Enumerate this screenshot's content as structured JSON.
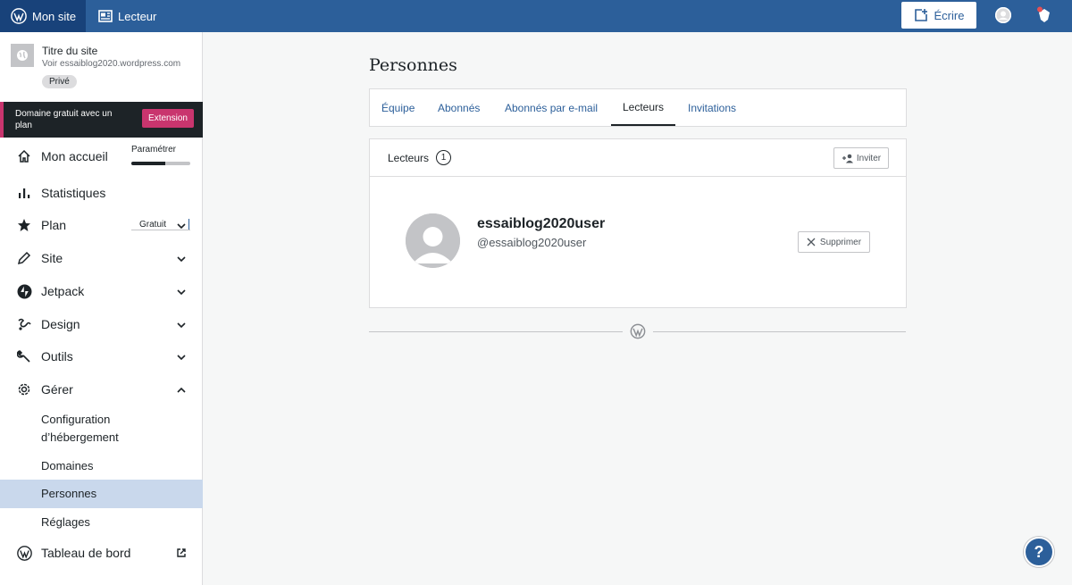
{
  "topbar": {
    "my_site": "Mon site",
    "reader": "Lecteur",
    "write": "Écrire"
  },
  "site": {
    "title": "Titre du site",
    "url": "Voir essaiblog2020.wordpress.com",
    "badge": "Privé"
  },
  "upsell": {
    "text": "Domaine gratuit avec un plan",
    "button": "Extension"
  },
  "nav": {
    "home": {
      "label": "Mon accueil",
      "extra": "Paramétrer",
      "progress_fraction": 0.58
    },
    "stats": {
      "label": "Statistiques"
    },
    "plan": {
      "label": "Plan",
      "extra": "Gratuit"
    },
    "site": {
      "label": "Site"
    },
    "jetpack": {
      "label": "Jetpack"
    },
    "design": {
      "label": "Design"
    },
    "tools": {
      "label": "Outils"
    },
    "manage": {
      "label": "Gérer",
      "sub": [
        "Configuration d’hébergement",
        "Domaines",
        "Personnes",
        "Réglages"
      ]
    },
    "dashboard": {
      "label": "Tableau de bord"
    }
  },
  "main": {
    "title": "Personnes",
    "tabs": [
      "Équipe",
      "Abonnés",
      "Abonnés par e-mail",
      "Lecteurs",
      "Invitations"
    ],
    "active_tab": "Lecteurs",
    "card": {
      "header": "Lecteurs",
      "count": "1",
      "invite": "Inviter"
    },
    "person": {
      "name": "essaiblog2020user",
      "handle": "@essaiblog2020user",
      "remove": "Supprimer"
    }
  },
  "help": {
    "label": "?"
  },
  "colors": {
    "topbar": "#2c5f9a",
    "topbar_active": "#18427a",
    "link": "#2c5f9a",
    "upsell_accent": "#c9356e",
    "active_nav": "#c9d8ec"
  }
}
